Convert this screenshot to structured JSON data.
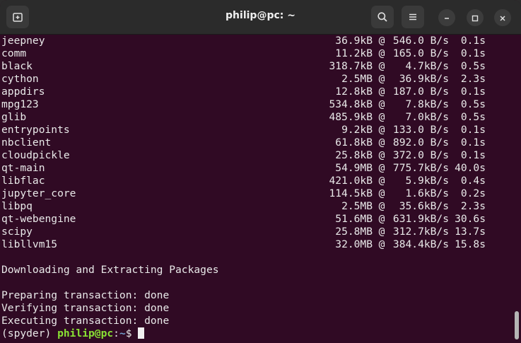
{
  "window": {
    "title": "philip@pc: ~"
  },
  "packages": [
    {
      "name": "jeepney",
      "size": "36.9kB",
      "rate": "546.0 B/s",
      "time": "0.1s"
    },
    {
      "name": "comm",
      "size": "11.2kB",
      "rate": "165.0 B/s",
      "time": "0.1s"
    },
    {
      "name": "black",
      "size": "318.7kB",
      "rate": "4.7kB/s",
      "time": "0.5s"
    },
    {
      "name": "cython",
      "size": "2.5MB",
      "rate": "36.9kB/s",
      "time": "2.3s"
    },
    {
      "name": "appdirs",
      "size": "12.8kB",
      "rate": "187.0 B/s",
      "time": "0.1s"
    },
    {
      "name": "mpg123",
      "size": "534.8kB",
      "rate": "7.8kB/s",
      "time": "0.5s"
    },
    {
      "name": "glib",
      "size": "485.9kB",
      "rate": "7.0kB/s",
      "time": "0.5s"
    },
    {
      "name": "entrypoints",
      "size": "9.2kB",
      "rate": "133.0 B/s",
      "time": "0.1s"
    },
    {
      "name": "nbclient",
      "size": "61.8kB",
      "rate": "892.0 B/s",
      "time": "0.1s"
    },
    {
      "name": "cloudpickle",
      "size": "25.8kB",
      "rate": "372.0 B/s",
      "time": "0.1s"
    },
    {
      "name": "qt-main",
      "size": "54.9MB",
      "rate": "775.7kB/s",
      "time": "40.0s"
    },
    {
      "name": "libflac",
      "size": "421.0kB",
      "rate": "5.9kB/s",
      "time": "0.4s"
    },
    {
      "name": "jupyter_core",
      "size": "114.5kB",
      "rate": "1.6kB/s",
      "time": "0.2s"
    },
    {
      "name": "libpq",
      "size": "2.5MB",
      "rate": "35.6kB/s",
      "time": "2.3s"
    },
    {
      "name": "qt-webengine",
      "size": "51.6MB",
      "rate": "631.9kB/s",
      "time": "30.6s"
    },
    {
      "name": "scipy",
      "size": "25.8MB",
      "rate": "312.7kB/s",
      "time": "13.7s"
    },
    {
      "name": "libllvm15",
      "size": "32.0MB",
      "rate": "384.4kB/s",
      "time": "15.8s"
    }
  ],
  "separator": "@",
  "messages": {
    "downloading": "Downloading and Extracting Packages",
    "preparing": "Preparing transaction: done",
    "verifying": "Verifying transaction: done",
    "executing": "Executing transaction: done"
  },
  "prompt": {
    "env": "(spyder) ",
    "user_host": "philip@pc",
    "colon": ":",
    "path": "~",
    "symbol": "$ "
  },
  "colors": {
    "background": "#300a24",
    "prompt_user": "#8ae234",
    "prompt_path": "#729fcf"
  },
  "icons": {
    "new_tab": "new-tab-icon",
    "search": "search-icon",
    "menu": "hamburger-menu-icon",
    "minimize": "minimize-icon",
    "maximize": "maximize-icon",
    "close": "close-icon"
  }
}
